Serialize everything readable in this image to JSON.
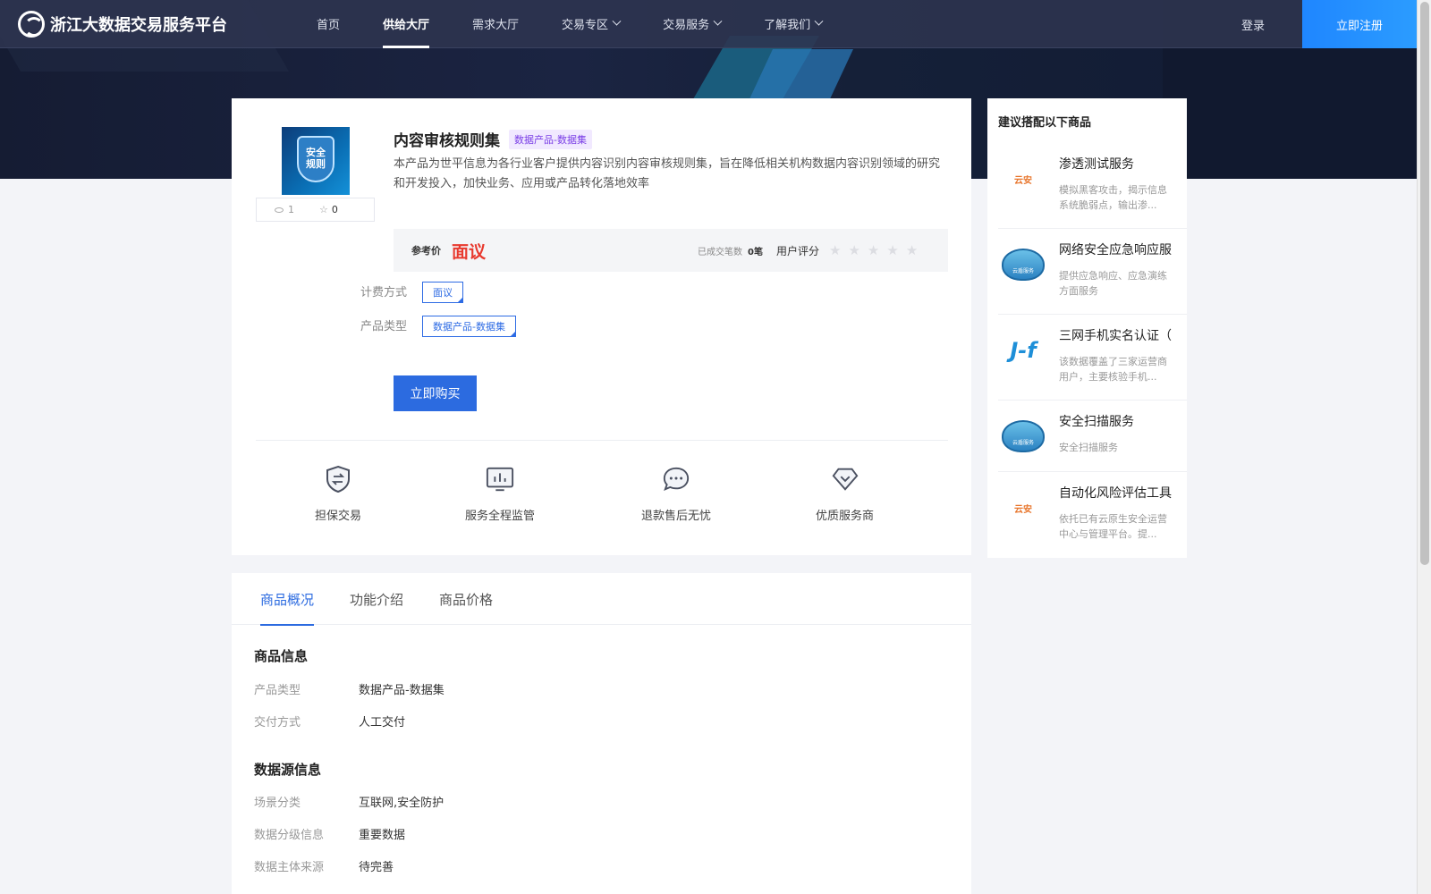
{
  "nav": {
    "logo_text": "浙江大数据交易服务平台",
    "items": [
      {
        "label": "首页",
        "active": false,
        "dropdown": false
      },
      {
        "label": "供给大厅",
        "active": true,
        "dropdown": false
      },
      {
        "label": "需求大厅",
        "active": false,
        "dropdown": false
      },
      {
        "label": "交易专区",
        "active": false,
        "dropdown": true
      },
      {
        "label": "交易服务",
        "active": false,
        "dropdown": true
      },
      {
        "label": "了解我们",
        "active": false,
        "dropdown": true
      }
    ],
    "login": "登录",
    "register": "立即注册"
  },
  "product": {
    "thumb_text": "安全\n规则",
    "views": "1",
    "favorites": "0",
    "title": "内容审核规则集",
    "category_tag": "数据产品-数据集",
    "description": "本产品为世平信息为各行业客户提供内容识别内容审核规则集，旨在降低相关机构数据内容识别领域的研究和开发投入，加快业务、应用或产品转化落地效率",
    "price_label": "参考价",
    "price_value": "面议",
    "deals_label": "已成交笔数",
    "deals_value": "0笔",
    "rating_label": "用户评分",
    "rating_stars": 0,
    "billing_label": "计费方式",
    "billing_value": "面议",
    "type_label": "产品类型",
    "type_value": "数据产品-数据集",
    "buy_button": "立即购买"
  },
  "features": [
    {
      "label": "担保交易",
      "icon": "shield-exchange-icon"
    },
    {
      "label": "服务全程监管",
      "icon": "monitor-chart-icon"
    },
    {
      "label": "退款售后无忧",
      "icon": "chat-bubble-icon"
    },
    {
      "label": "优质服务商",
      "icon": "diamond-icon"
    }
  ],
  "tabs": [
    {
      "label": "商品概况",
      "active": true
    },
    {
      "label": "功能介绍",
      "active": false
    },
    {
      "label": "商品价格",
      "active": false
    }
  ],
  "detail": {
    "section1_title": "商品信息",
    "section1_rows": [
      {
        "label": "产品类型",
        "value": "数据产品-数据集"
      },
      {
        "label": "交付方式",
        "value": "人工交付"
      }
    ],
    "section2_title": "数据源信息",
    "section2_rows": [
      {
        "label": "场景分类",
        "value": "互联网,安全防护"
      },
      {
        "label": "数据分级信息",
        "value": "重要数据"
      },
      {
        "label": "数据主体来源",
        "value": "待完善"
      }
    ]
  },
  "recommend": {
    "title": "建议搭配以下商品",
    "items": [
      {
        "name": "渗透测试服务",
        "desc": "模拟黑客攻击，揭示信息系统脆弱点，输出渗...",
        "logo": "orange-brand-logo",
        "logo_text": "云安"
      },
      {
        "name": "网络安全应急响应服",
        "desc": "提供应急响应、应急演练方面服务",
        "logo": "cloud-shield-logo",
        "logo_text": "云盾服务"
      },
      {
        "name": "三网手机实名认证（",
        "desc": "该数据覆盖了三家运营商用户，主要核验手机...",
        "logo": "jf-logo",
        "logo_text": "J-f"
      },
      {
        "name": "安全扫描服务",
        "desc": "安全扫描服务",
        "logo": "cloud-shield-logo",
        "logo_text": "云盾服务"
      },
      {
        "name": "自动化风险评估工具",
        "desc": "依托已有云原生安全运营中心与管理平台。提...",
        "logo": "orange-brand-logo",
        "logo_text": "云安"
      }
    ]
  },
  "colors": {
    "primary": "#2c6be0",
    "price": "#e8392e",
    "tag_purple": "#7a3ee6",
    "register": "#1f86ff"
  }
}
